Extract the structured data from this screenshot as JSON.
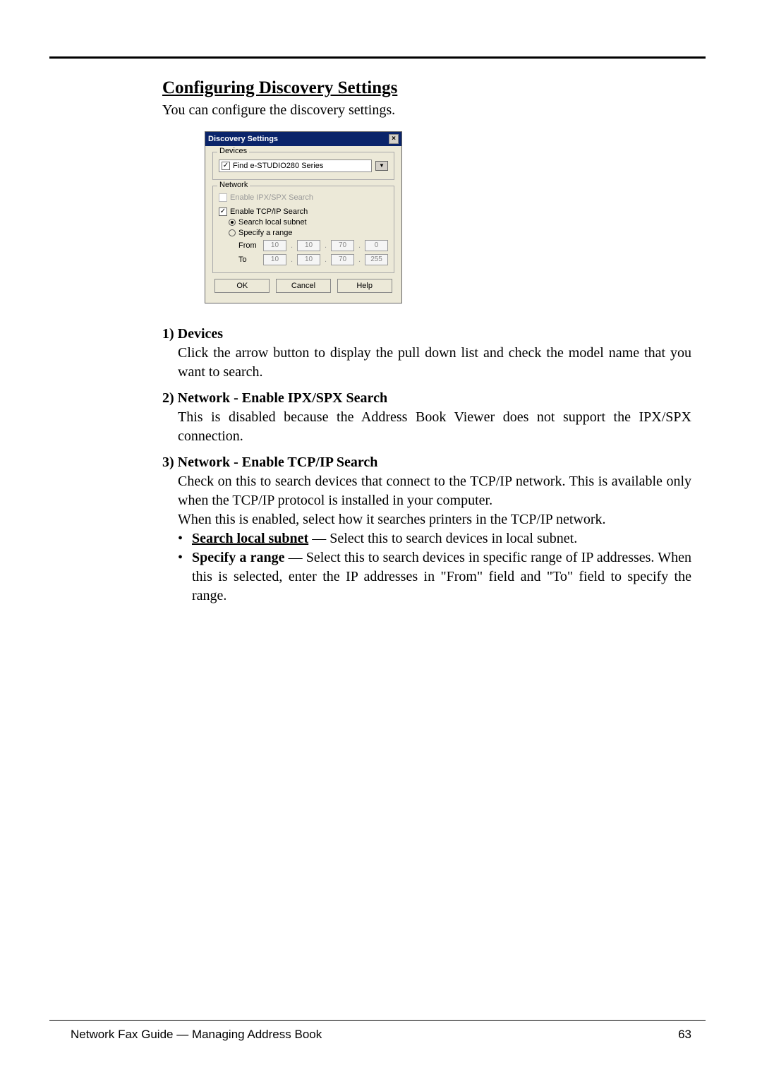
{
  "heading": "Configuring Discovery Settings",
  "intro": "You can configure the discovery settings.",
  "dialog": {
    "title": "Discovery Settings",
    "close": "×",
    "devices_legend": "Devices",
    "find_checked": "✓",
    "find_label": "Find e-STUDIO280 Series",
    "dropdown_glyph": "▼",
    "network_legend": "Network",
    "ipxspx_label": "Enable IPX/SPX Search",
    "tcpip_label": "Enable TCP/IP Search",
    "tcpip_checked": "✓",
    "search_subnet": "Search local subnet",
    "specify_range": "Specify a range",
    "from_label": "From",
    "to_label": "To",
    "from_ip": [
      "10",
      "10",
      "70",
      "0"
    ],
    "to_ip": [
      "10",
      "10",
      "70",
      "255"
    ],
    "ok": "OK",
    "cancel": "Cancel",
    "help": "Help"
  },
  "defs": {
    "d1_lead": "1) Devices",
    "d1_body": "Click the arrow button to display the pull down list and check the model name that you want to search.",
    "d2_lead": "2) Network - Enable IPX/SPX Search",
    "d2_body": "This is disabled because the Address Book Viewer does not support the IPX/SPX connection.",
    "d3_lead": "3) Network - Enable TCP/IP Search",
    "d3_body1": "Check on this to search devices that connect to the TCP/IP network.  This is available only when the TCP/IP protocol is installed in your computer.",
    "d3_body2": "When this is enabled, select how it searches printers in the TCP/IP network.",
    "b1_bold": "Search local subnet",
    "b1_rest": " — Select this to search devices in local subnet.",
    "b2_bold": "Specify a range",
    "b2_rest": " — Select this to search devices in specific range of IP addresses.  When this is selected, enter the IP addresses in \"From\" field and \"To\" field to specify the range."
  },
  "footer": {
    "left": "Network Fax Guide — Managing Address Book",
    "right": "63"
  }
}
